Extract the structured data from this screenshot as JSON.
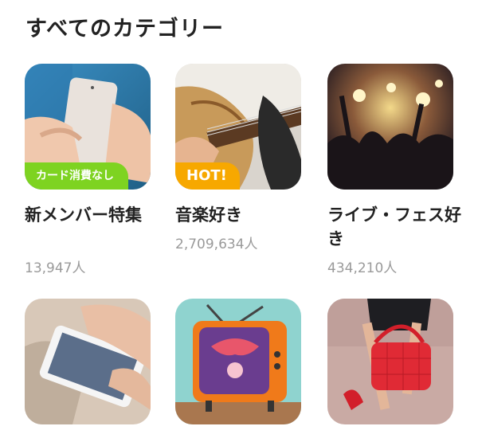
{
  "page": {
    "title": "すべてのカテゴリー"
  },
  "categories": [
    {
      "name": "新メンバー特集",
      "count": "13,947人",
      "badge": "カード消費なし"
    },
    {
      "name": "音楽好き",
      "count": "2,709,634人",
      "badge": "HOT!"
    },
    {
      "name": "ライブ・フェス好き",
      "count": "434,210人"
    },
    {
      "name": "",
      "count": ""
    },
    {
      "name": "",
      "count": ""
    },
    {
      "name": "",
      "count": ""
    }
  ],
  "colors": {
    "badge_green": "#7ed321",
    "badge_orange": "#f7a800"
  }
}
